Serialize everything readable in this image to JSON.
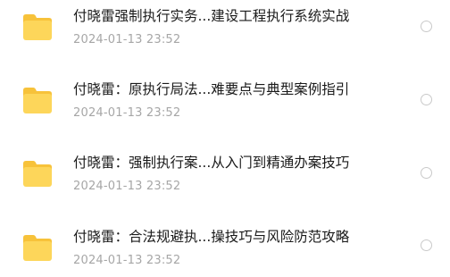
{
  "files": [
    {
      "title": "付晓雷强制执行实务...建设工程执行系统实战",
      "date": "2024-01-13 23:52",
      "icon": "folder-icon"
    },
    {
      "title": "付晓雷：原执行局法...难要点与典型案例指引",
      "date": "2024-01-13 23:52",
      "icon": "folder-icon"
    },
    {
      "title": "付晓雷：强制执行案...从入门到精通办案技巧",
      "date": "2024-01-13 23:52",
      "icon": "folder-icon"
    },
    {
      "title": "付晓雷：合法规避执...操技巧与风险防范攻略",
      "date": "2024-01-13 23:52",
      "icon": "folder-icon"
    }
  ],
  "colors": {
    "folder_light": "#FDD65A",
    "folder_dark": "#F7C23A",
    "title": "#1a1a1a",
    "date": "#a6a6a6",
    "radio_border": "#c9c9c9"
  }
}
